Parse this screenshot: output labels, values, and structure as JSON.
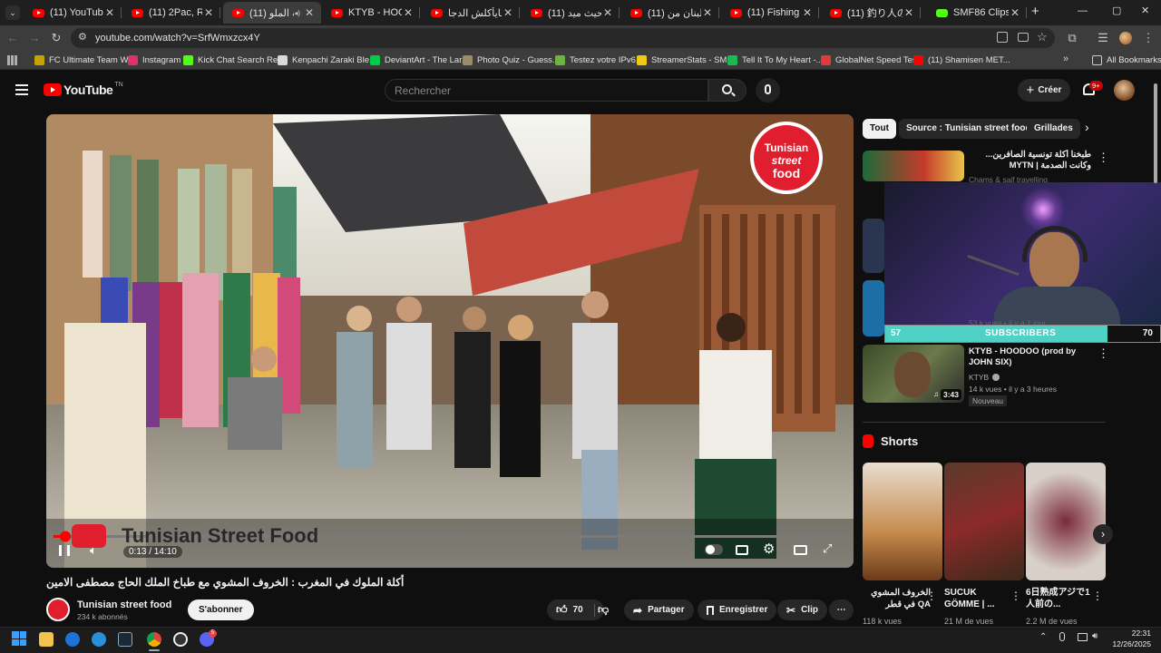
{
  "browser": {
    "tabs": [
      {
        "title": "(11) YouTube",
        "type": "yt"
      },
      {
        "title": "(11) 2Pac, R.L. Hu",
        "type": "yt"
      },
      {
        "title": "(11) أكلة الملو",
        "type": "yt",
        "active": true
      },
      {
        "title": "KTYB - HOODOO",
        "type": "yt"
      },
      {
        "title": "الي مايأكلش الدجا",
        "type": "yt"
      },
      {
        "title": "(11) كان حيث ميد",
        "type": "yt"
      },
      {
        "title": "(11) دخلت لبنان من",
        "type": "yt"
      },
      {
        "title": "(11) Fishing Reel",
        "type": "yt"
      },
      {
        "title": "(11) 釣り人の夢を",
        "type": "yt"
      },
      {
        "title": "SMF86 Clips - Wa",
        "type": "kick"
      }
    ],
    "new_tab": "+",
    "window_controls": [
      "—",
      "▢",
      "✕"
    ],
    "url": "youtube.com/watch?v=SrfWmxzcx4Y",
    "bookmarks": [
      {
        "label": "FC Ultimate Team W...",
        "color": "#c5a300"
      },
      {
        "label": "Instagram",
        "color": "#e1306c"
      },
      {
        "label": "Kick Chat Search Re...",
        "color": "#53fc18"
      },
      {
        "label": "Kenpachi Zaraki Ble...",
        "color": "#d9d9d9"
      },
      {
        "label": "DeviantArt - The Lar...",
        "color": "#05cc47"
      },
      {
        "label": "Photo Quiz - Guess...",
        "color": "#9b8b6b"
      },
      {
        "label": "Testez votre IPv6.",
        "color": "#6db33f"
      },
      {
        "label": "StreamerStats - SMF...",
        "color": "#f2c811"
      },
      {
        "label": "Tell It To My Heart -...",
        "color": "#1db954"
      },
      {
        "label": "GlobalNet Speed Test",
        "color": "#e23a3a"
      },
      {
        "label": "(11) Shamisen MET...",
        "color": "#ff0000"
      }
    ],
    "all_bookmarks": "All Bookmarks"
  },
  "youtube": {
    "logo": "YouTube",
    "logo_sup": "TN",
    "search_placeholder": "Rechercher",
    "create_label": "Créer",
    "notif_badge": "9+",
    "video": {
      "time": "0:13 / 14:10",
      "watermark": "Tunisian Street Food",
      "logo_text_1": "Tunisian",
      "logo_text_2": "street",
      "logo_text_3": "food",
      "progress": 0.015
    },
    "video_title": "أكلة الملوك في المغرب : الخروف المشوي مع طباخ الملك الحاج مصطفى الامين",
    "channel": {
      "name": "Tunisian street food",
      "subs": "234 k abonnés"
    },
    "subscribe": "S'abonner",
    "likes": "70",
    "share": "Partager",
    "save": "Enregistrer",
    "clip": "Clip",
    "chips": [
      "Tout",
      "Source : Tunisian street food",
      "Grillades"
    ],
    "recs": [
      {
        "title": "طبخنا أكلة تونسية الصافرين... وكانت الصدمة | MYTN",
        "channel": "Chams & saif travelling",
        "verified": true
      },
      {
        "title": "KTYB - HOODOO (prod by JOHN SIX)",
        "channel": "KTYB",
        "meta": "14 k vues • il y a 3 heures",
        "badge": "Nouveau",
        "duration": "3:43",
        "partial_meta": "53 k vues • il y a 1 jour"
      }
    ],
    "overlay": {
      "left": "57",
      "label": "SUBSCRIBERS",
      "right": "70",
      "progress": 0.81
    },
    "shorts_label": "Shorts",
    "shorts": [
      {
        "title": "الخروف المشوي QA في قطر",
        "views": "118 k vues"
      },
      {
        "title": "SUCUK GÖMME | ...",
        "views": "21 M de vues"
      },
      {
        "title": "6日熟成アジで1人前の...",
        "views": "2.2 M de vues"
      }
    ]
  },
  "taskbar": {
    "time": "22:31",
    "date": "12/26/2025",
    "notif": "5"
  }
}
